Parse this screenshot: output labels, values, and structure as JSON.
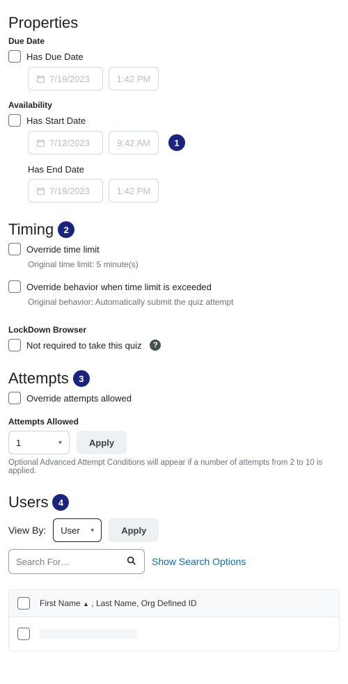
{
  "annotations": {
    "a1": "1",
    "a2": "2",
    "a3": "3",
    "a4": "4"
  },
  "properties": {
    "heading": "Properties",
    "due": {
      "label": "Due Date",
      "has_label": "Has Due Date",
      "date_placeholder": "7/19/2023",
      "time_placeholder": "1:42 PM"
    },
    "availability": {
      "label": "Availability",
      "start": {
        "has_label": "Has Start Date",
        "date_placeholder": "7/12/2023",
        "time_placeholder": "9:42 AM"
      },
      "end": {
        "has_label": "Has End Date",
        "date_placeholder": "7/19/2023",
        "time_placeholder": "1:42 PM"
      }
    }
  },
  "timing": {
    "heading": "Timing",
    "override_time_label": "Override time limit",
    "original_time_hint": "Original time limit: 5 minute(s)",
    "override_behavior_label": "Override behavior when time limit is exceeded",
    "original_behavior_hint": "Original behavior: Automatically submit the quiz attempt",
    "lockdown_heading": "LockDown Browser",
    "lockdown_label": "Not required to take this quiz"
  },
  "attempts": {
    "heading": "Attempts",
    "override_label": "Override attempts allowed",
    "allowed_heading": "Attempts Allowed",
    "allowed_value": "1",
    "apply_label": "Apply",
    "note": "Optional Advanced Attempt Conditions will appear if a number of attempts from 2 to 10 is applied."
  },
  "users": {
    "heading": "Users",
    "viewby_label": "View By:",
    "viewby_value": "User",
    "apply_label": "Apply",
    "search_placeholder": "Search For…",
    "show_search_options": "Show Search Options",
    "table_header": "First Name",
    "table_header_rest": ", Last Name, Org Defined ID"
  }
}
